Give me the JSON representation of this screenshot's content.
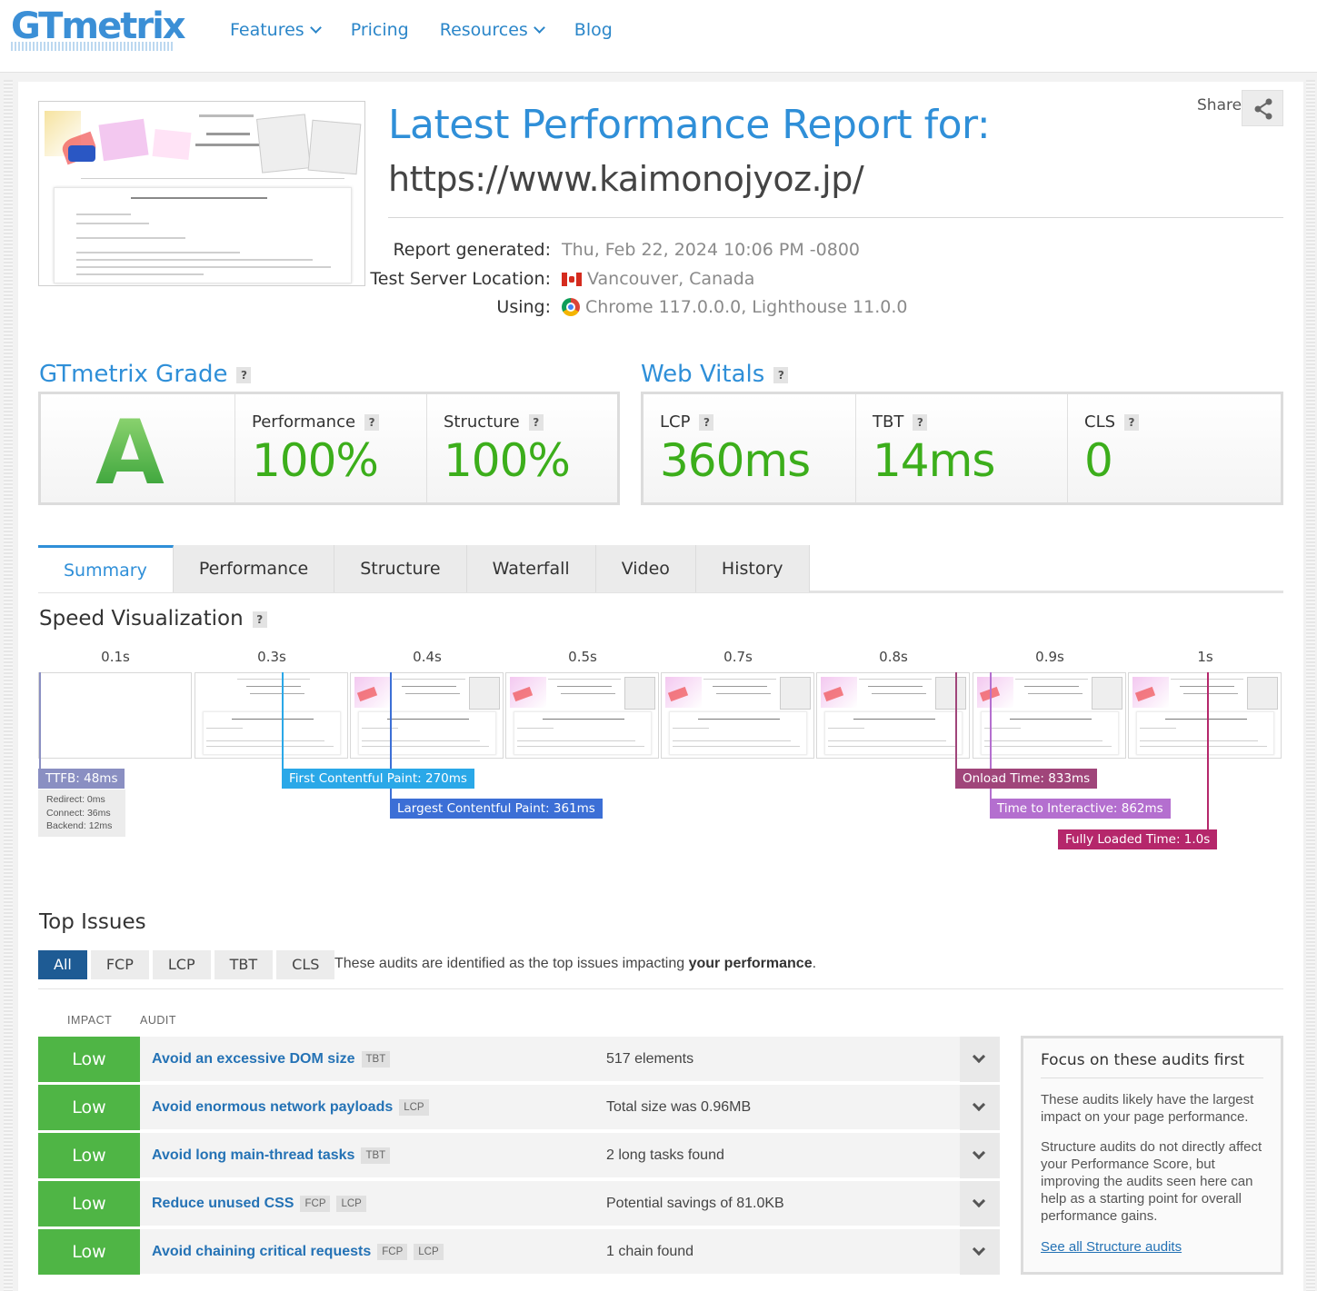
{
  "nav": {
    "logo": "GTmetrix",
    "items": [
      "Features",
      "Pricing",
      "Resources",
      "Blog"
    ]
  },
  "report": {
    "title": "Latest Performance Report for:",
    "url": "https://www.kaimonojyoz.jp/",
    "share_label": "Share",
    "meta": [
      {
        "label": "Report generated:",
        "value": "Thu, Feb 22, 2024 10:06 PM -0800"
      },
      {
        "label": "Test Server Location:",
        "value": "Vancouver, Canada"
      },
      {
        "label": "Using:",
        "value": "Chrome 117.0.0.0, Lighthouse 11.0.0"
      }
    ]
  },
  "grade": {
    "title": "GTmetrix Grade",
    "letter": "A",
    "performance_label": "Performance",
    "performance_value": "100%",
    "structure_label": "Structure",
    "structure_value": "100%"
  },
  "vitals": {
    "title": "Web Vitals",
    "lcp_label": "LCP",
    "lcp_value": "360ms",
    "tbt_label": "TBT",
    "tbt_value": "14ms",
    "cls_label": "CLS",
    "cls_value": "0"
  },
  "tabs": [
    "Summary",
    "Performance",
    "Structure",
    "Waterfall",
    "Video",
    "History"
  ],
  "speed": {
    "title": "Speed Visualization",
    "times": [
      "0.1s",
      "0.3s",
      "0.4s",
      "0.5s",
      "0.7s",
      "0.8s",
      "0.9s",
      "1s"
    ],
    "ttfb": "TTFB: 48ms",
    "ttfb_details": [
      "Redirect: 0ms",
      "Connect: 36ms",
      "Backend: 12ms"
    ],
    "fcp": "First Contentful Paint: 270ms",
    "lcp": "Largest Contentful Paint: 361ms",
    "onload": "Onload Time: 833ms",
    "tti": "Time to Interactive: 862ms",
    "fully_loaded": "Fully Loaded Time: 1.0s"
  },
  "issues": {
    "title": "Top Issues",
    "filters": [
      "All",
      "FCP",
      "LCP",
      "TBT",
      "CLS"
    ],
    "note_prefix": "These audits are identified as the top issues impacting ",
    "note_bold": "your performance",
    "note_suffix": ".",
    "col_impact": "IMPACT",
    "col_audit": "AUDIT",
    "rows": [
      {
        "impact": "Low",
        "audit": "Avoid an excessive DOM size",
        "tags": [
          "TBT"
        ],
        "result": "517 elements"
      },
      {
        "impact": "Low",
        "audit": "Avoid enormous network payloads",
        "tags": [
          "LCP"
        ],
        "result": "Total size was 0.96MB"
      },
      {
        "impact": "Low",
        "audit": "Avoid long main-thread tasks",
        "tags": [
          "TBT"
        ],
        "result": "2 long tasks found"
      },
      {
        "impact": "Low",
        "audit": "Reduce unused CSS",
        "tags": [
          "FCP",
          "LCP"
        ],
        "result": "Potential savings of 81.0KB"
      },
      {
        "impact": "Low",
        "audit": "Avoid chaining critical requests",
        "tags": [
          "FCP",
          "LCP"
        ],
        "result": "1 chain found"
      }
    ],
    "focus": {
      "title": "Focus on these audits first",
      "p1": "These audits likely have the largest impact on your page performance.",
      "p2": "Structure audits do not directly affect your Performance Score, but improving the audits seen here can help as a starting point for overall performance gains.",
      "link": "See all Structure audits"
    }
  },
  "colors": {
    "brand_blue": "#2f8fd8",
    "grade_green": "#3cae1b",
    "impact_low": "#4fb545",
    "ttfb": "#8a8fc2",
    "fcp": "#2aa8e8",
    "lcp": "#3c6fd6",
    "onload": "#a0457a",
    "tti": "#b46fcf",
    "fully_loaded": "#b5276b"
  }
}
